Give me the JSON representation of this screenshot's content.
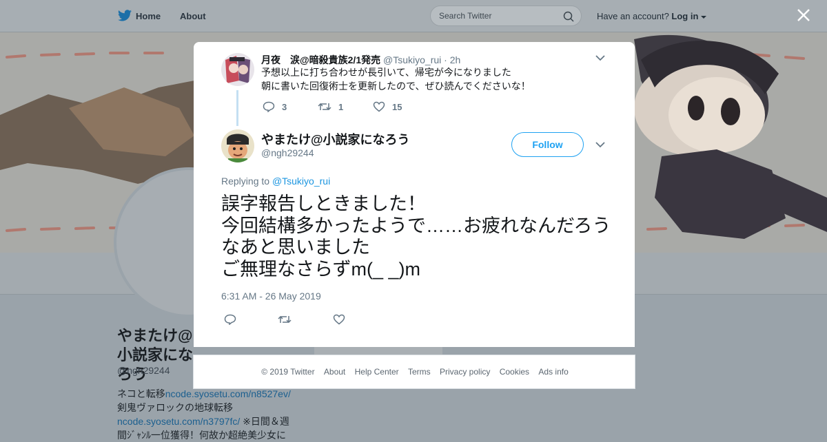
{
  "topbar": {
    "home_label": "Home",
    "about_label": "About",
    "search_placeholder": "Search Twitter",
    "have_account": "Have an account?",
    "login_label": "Log in"
  },
  "profile": {
    "name": "やまたけ@小説家になろう",
    "handle": "@ngh29244",
    "bio_line1": "ネコと転移",
    "bio_link1": "ncode.syosetu.com/n8527ev/",
    "bio_line2": "剣鬼ヴァロックの地球転移",
    "bio_link2": "ncode.syosetu.com/n3797fc/",
    "bio_line3": "※日間＆週間ｼﾞｬﾝﾙ一位獲得！何故か超絶美少女に"
  },
  "parent_tweet": {
    "name": "月夜　涙@暗殺貴族2/1発売",
    "handle": "@Tsukiyo_rui",
    "time": "· 2h",
    "line1": "予想以上に打ち合わせが長引いて、帰宅が今になりました",
    "line2": "朝に書いた回復術士を更新したので、ぜひ読んでくださいな！",
    "replies": "3",
    "retweets": "1",
    "likes": "15"
  },
  "main_tweet": {
    "name": "やまたけ@小説家になろう",
    "handle": "@ngh29244",
    "follow_label": "Follow",
    "replying_prefix": "Replying to",
    "replying_to": "@Tsukiyo_rui",
    "text_line1": "誤字報告しときました！",
    "text_line2": "今回結構多かったようで……お疲れなんだろうなあと思いました",
    "text_line3": "ご無理なさらずm(_ _)m",
    "timestamp": "6:31 AM - 26 May 2019"
  },
  "footer": {
    "links": [
      "© 2019 Twitter",
      "About",
      "Help Center",
      "Terms",
      "Privacy policy",
      "Cookies",
      "Ads info"
    ]
  },
  "colors": {
    "twitter_blue": "#1da1f2",
    "link_blue": "#1b95e0",
    "overlay": "#9aa3aa"
  }
}
